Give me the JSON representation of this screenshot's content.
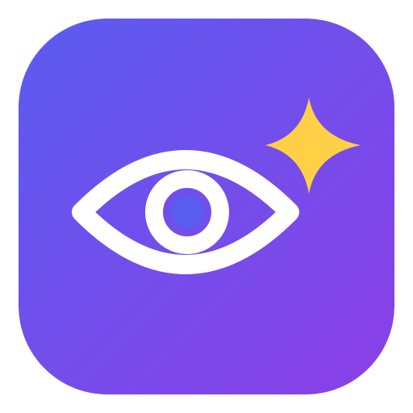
{
  "icon": {
    "name": "eye-sparkle-app-icon",
    "glyphs": [
      "eye-icon",
      "sparkle-icon"
    ],
    "colors": {
      "background": "#ffffff",
      "gradient_start": "#5B5CF0",
      "gradient_end": "#8B3FE6",
      "eye_stroke": "#ffffff",
      "pupil": "#5B5CF0",
      "sparkle": "#FFD046"
    }
  }
}
